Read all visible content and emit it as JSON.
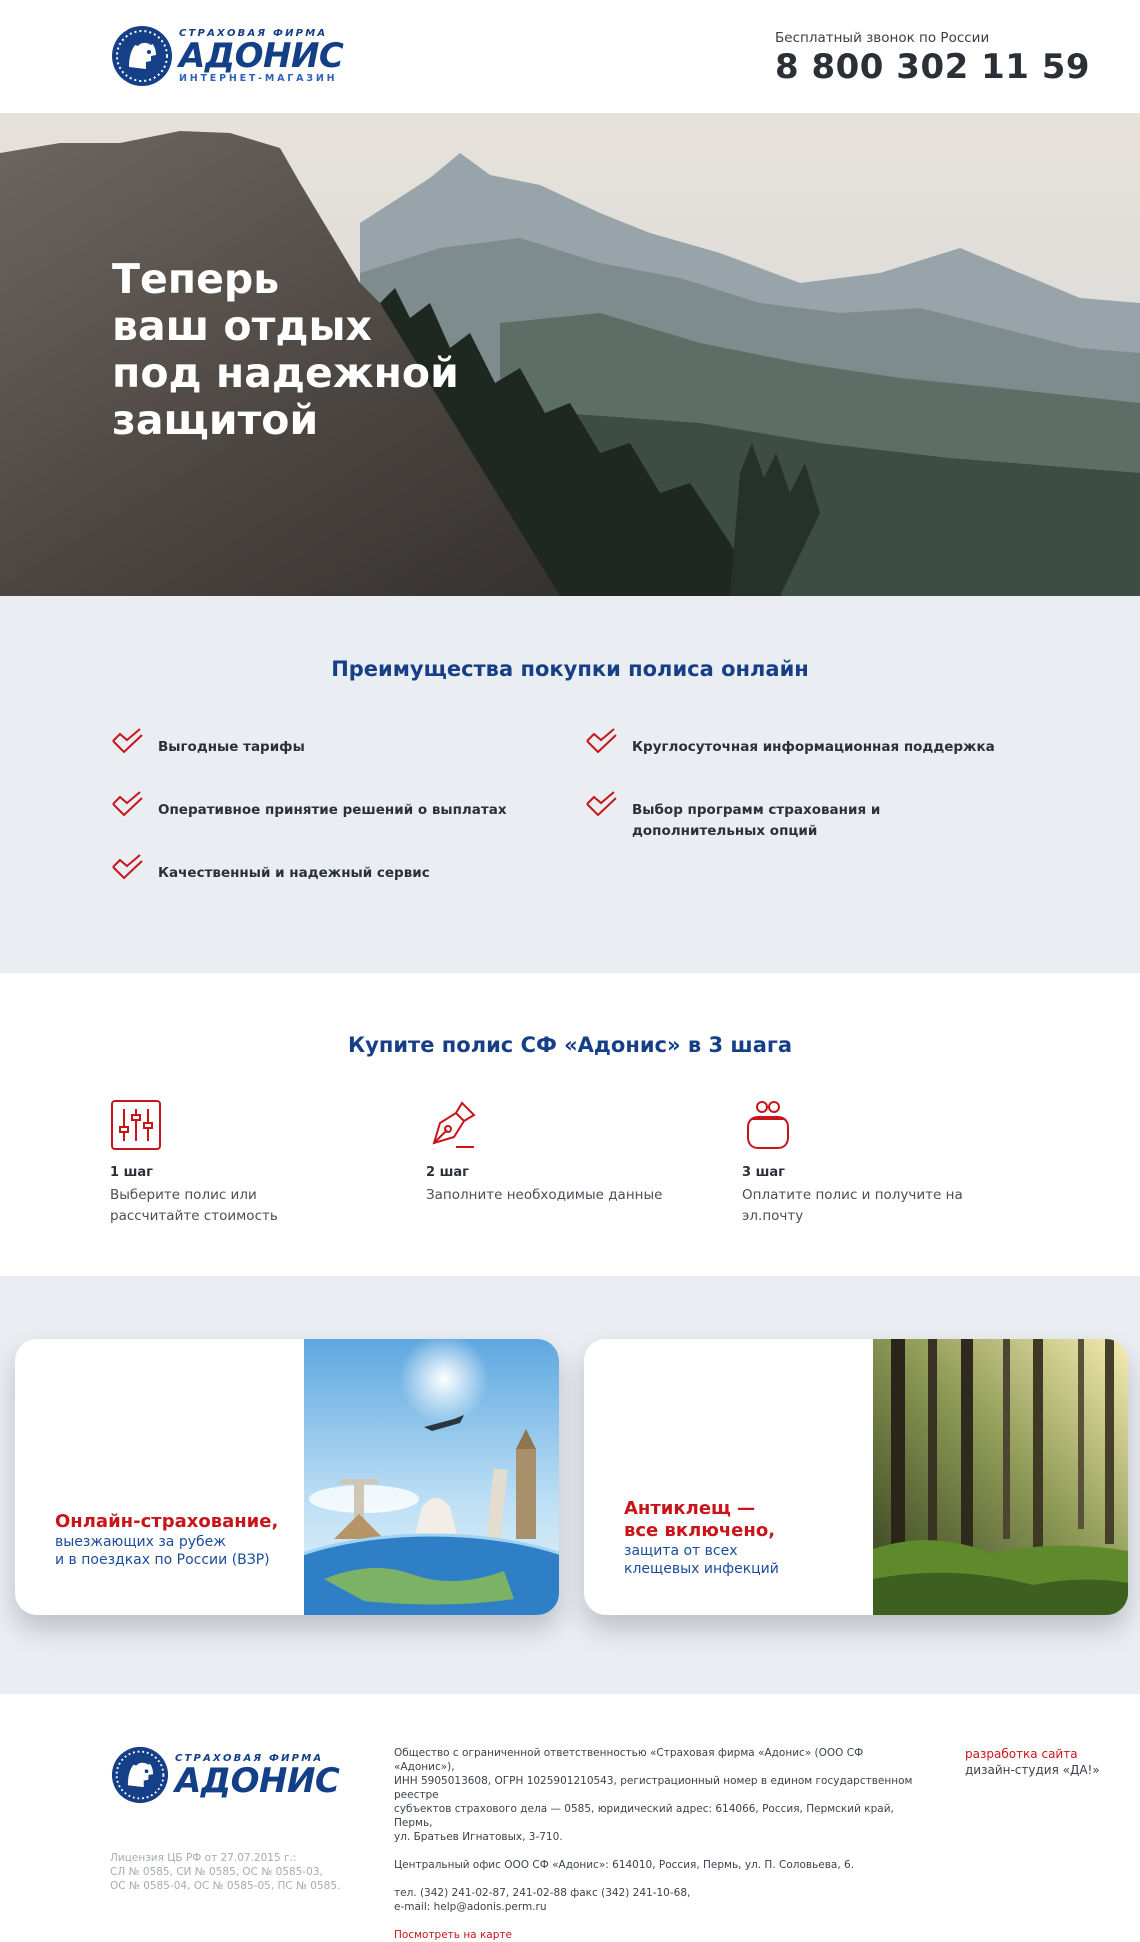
{
  "header": {
    "logo": {
      "top_text": "СТРАХОВАЯ ФИРМА",
      "name": "АДОНИС",
      "bottom_text": "ИНТЕРНЕТ-МАГАЗИН"
    },
    "phone_caption": "Бесплатный звонок по России",
    "phone_number": "8 800 302 11 59"
  },
  "hero": {
    "title_lines": [
      "Теперь",
      "ваш отдых",
      "под надежной",
      "защитой"
    ]
  },
  "advantages": {
    "title": "Преимущества покупки полиса онлайн",
    "items": [
      "Выгодные тарифы",
      "Круглосуточная информационная поддержка",
      "Оперативное принятие решений о выплатах",
      "Выбор программ страхования и дополнительных опций",
      "Качественный и надежный сервис"
    ]
  },
  "steps": {
    "title": "Купите полис СФ «Адонис» в 3 шага",
    "items": [
      {
        "num": "1 шаг",
        "text": "Выберите полис или рассчитайте стоимость",
        "icon": "sliders-icon"
      },
      {
        "num": "2 шаг",
        "text": "Заполните необходимые данные",
        "icon": "pen-icon"
      },
      {
        "num": "3 шаг",
        "text": "Оплатите полис и получите на эл.почту",
        "icon": "wallet-icon"
      }
    ]
  },
  "cards": [
    {
      "title": "Онлайн-страхование,",
      "subtitle_lines": [
        "выезжающих за рубеж",
        "и в поездках по России (ВЗР)"
      ],
      "image": "travel-landmarks-image"
    },
    {
      "title_lines": [
        "Антиклещ —",
        "все включено,"
      ],
      "subtitle_lines": [
        "защита от всех",
        "клещевых инфекций"
      ],
      "image": "sunlit-forest-image"
    }
  ],
  "footer": {
    "logo": {
      "top_text": "СТРАХОВАЯ ФИРМА",
      "name": "АДОНИС"
    },
    "license_lines": [
      "Лицензия ЦБ РФ от 27.07.2015 г.:",
      "СЛ № 0585, СИ № 0585, ОС № 0585-03,",
      "ОС № 0585-04, ОС № 0585-05, ПС № 0585."
    ],
    "company_lines": [
      "Общество с ограниченной ответственностью «Страховая фирма «Адонис» (ООО СФ «Адонис»),",
      "ИНН 5905013608, ОГРН 1025901210543, регистрационный номер в едином государственном реестре",
      "субъектов страхового дела — 0585, юридический адрес: 614066, Россия, Пермский край, Пермь,",
      "ул. Братьев Игнатовых, 3-710."
    ],
    "office": "Центральный офис ООО СФ «Адонис»: 614010, Россия, Пермь, ул. П. Соловьева, 6.",
    "contacts_lines": [
      "тел. (342) 241-02-87, 241-02-88 факс (342) 241-10-68,",
      "e-mail: help@adonis.perm.ru"
    ],
    "map_link": "Посмотреть на карте",
    "dev_link": "разработка сайта",
    "dev_studio": "дизайн-студия «ДА!»"
  },
  "colors": {
    "brand_blue": "#163f87",
    "accent_red": "#c8151b",
    "section_bg": "#eaedf1"
  }
}
